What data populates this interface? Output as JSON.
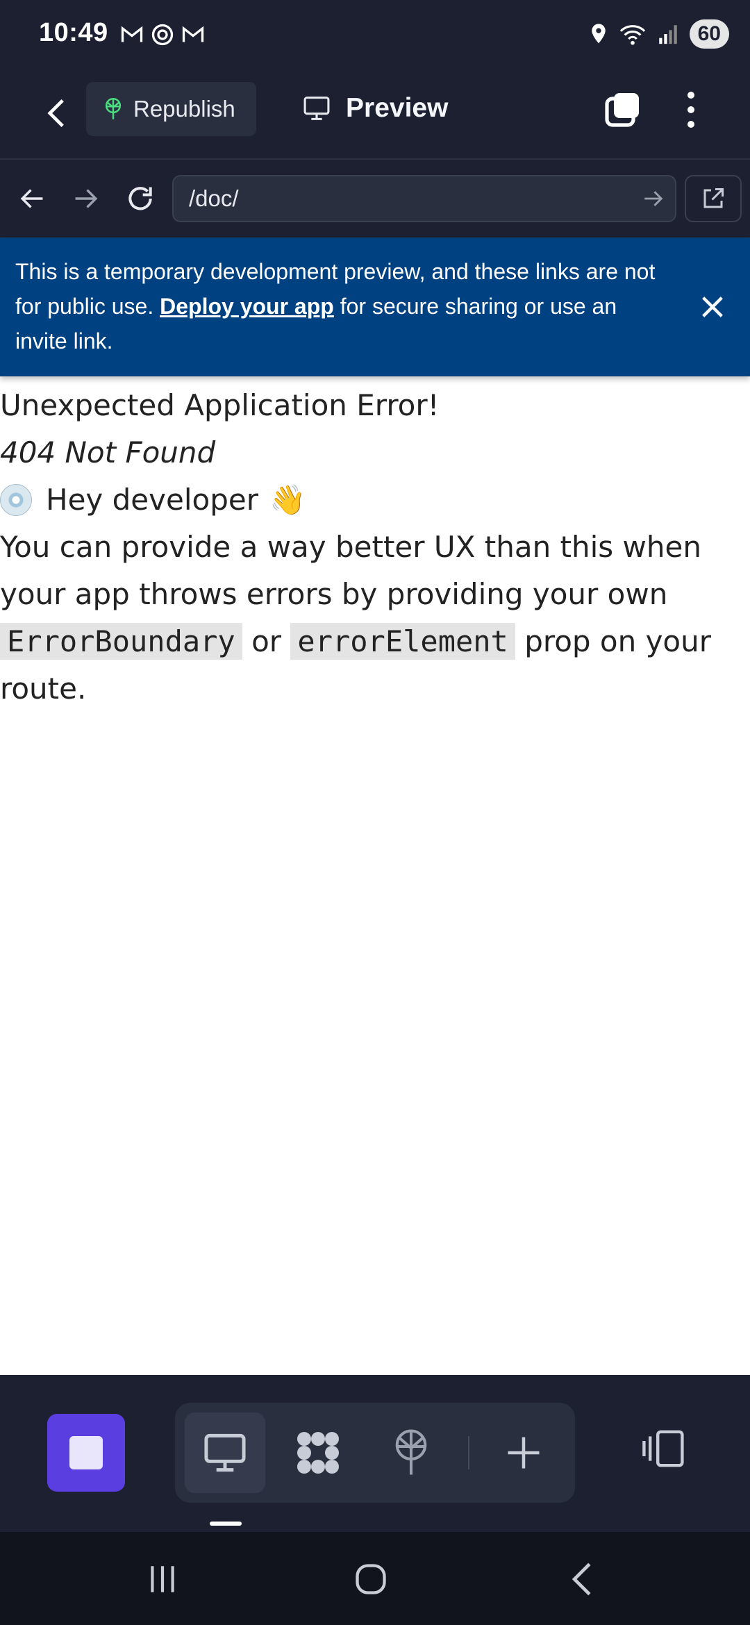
{
  "status_bar": {
    "time": "10:49",
    "notification_icons": [
      "gmail-icon",
      "threads-icon",
      "gmail-icon"
    ],
    "battery": "60",
    "right_icons": [
      "location-icon",
      "wifi-icon",
      "signal-icon"
    ]
  },
  "app_bar": {
    "republish_label": "Republish",
    "preview_label": "Preview"
  },
  "url_bar": {
    "url": "/doc/"
  },
  "banner": {
    "text_before_link": "This is a temporary development preview, and these links are not for public use. ",
    "link_text": "Deploy your app",
    "text_after_link": " for secure sharing or use an invite link."
  },
  "error_page": {
    "title": "Unexpected Application Error!",
    "status": "404 Not Found",
    "greeting": "Hey developer",
    "greeting_emoji": "👋",
    "body_part1": "You can provide a way better UX than this when your app throws errors by providing your own ",
    "code1": "ErrorBoundary",
    "body_part2": " or ",
    "code2": "errorElement",
    "body_part3": " prop on your route."
  },
  "bottom_toolbar": {
    "tools": [
      "desktop-icon",
      "apps-icon",
      "deploy-icon",
      "plus-icon"
    ],
    "active_tool": "desktop-icon"
  },
  "colors": {
    "app_background": "#1c2030",
    "banner": "#004182",
    "stop_button": "#5b3ee0",
    "republish_accent": "#4ade80"
  }
}
